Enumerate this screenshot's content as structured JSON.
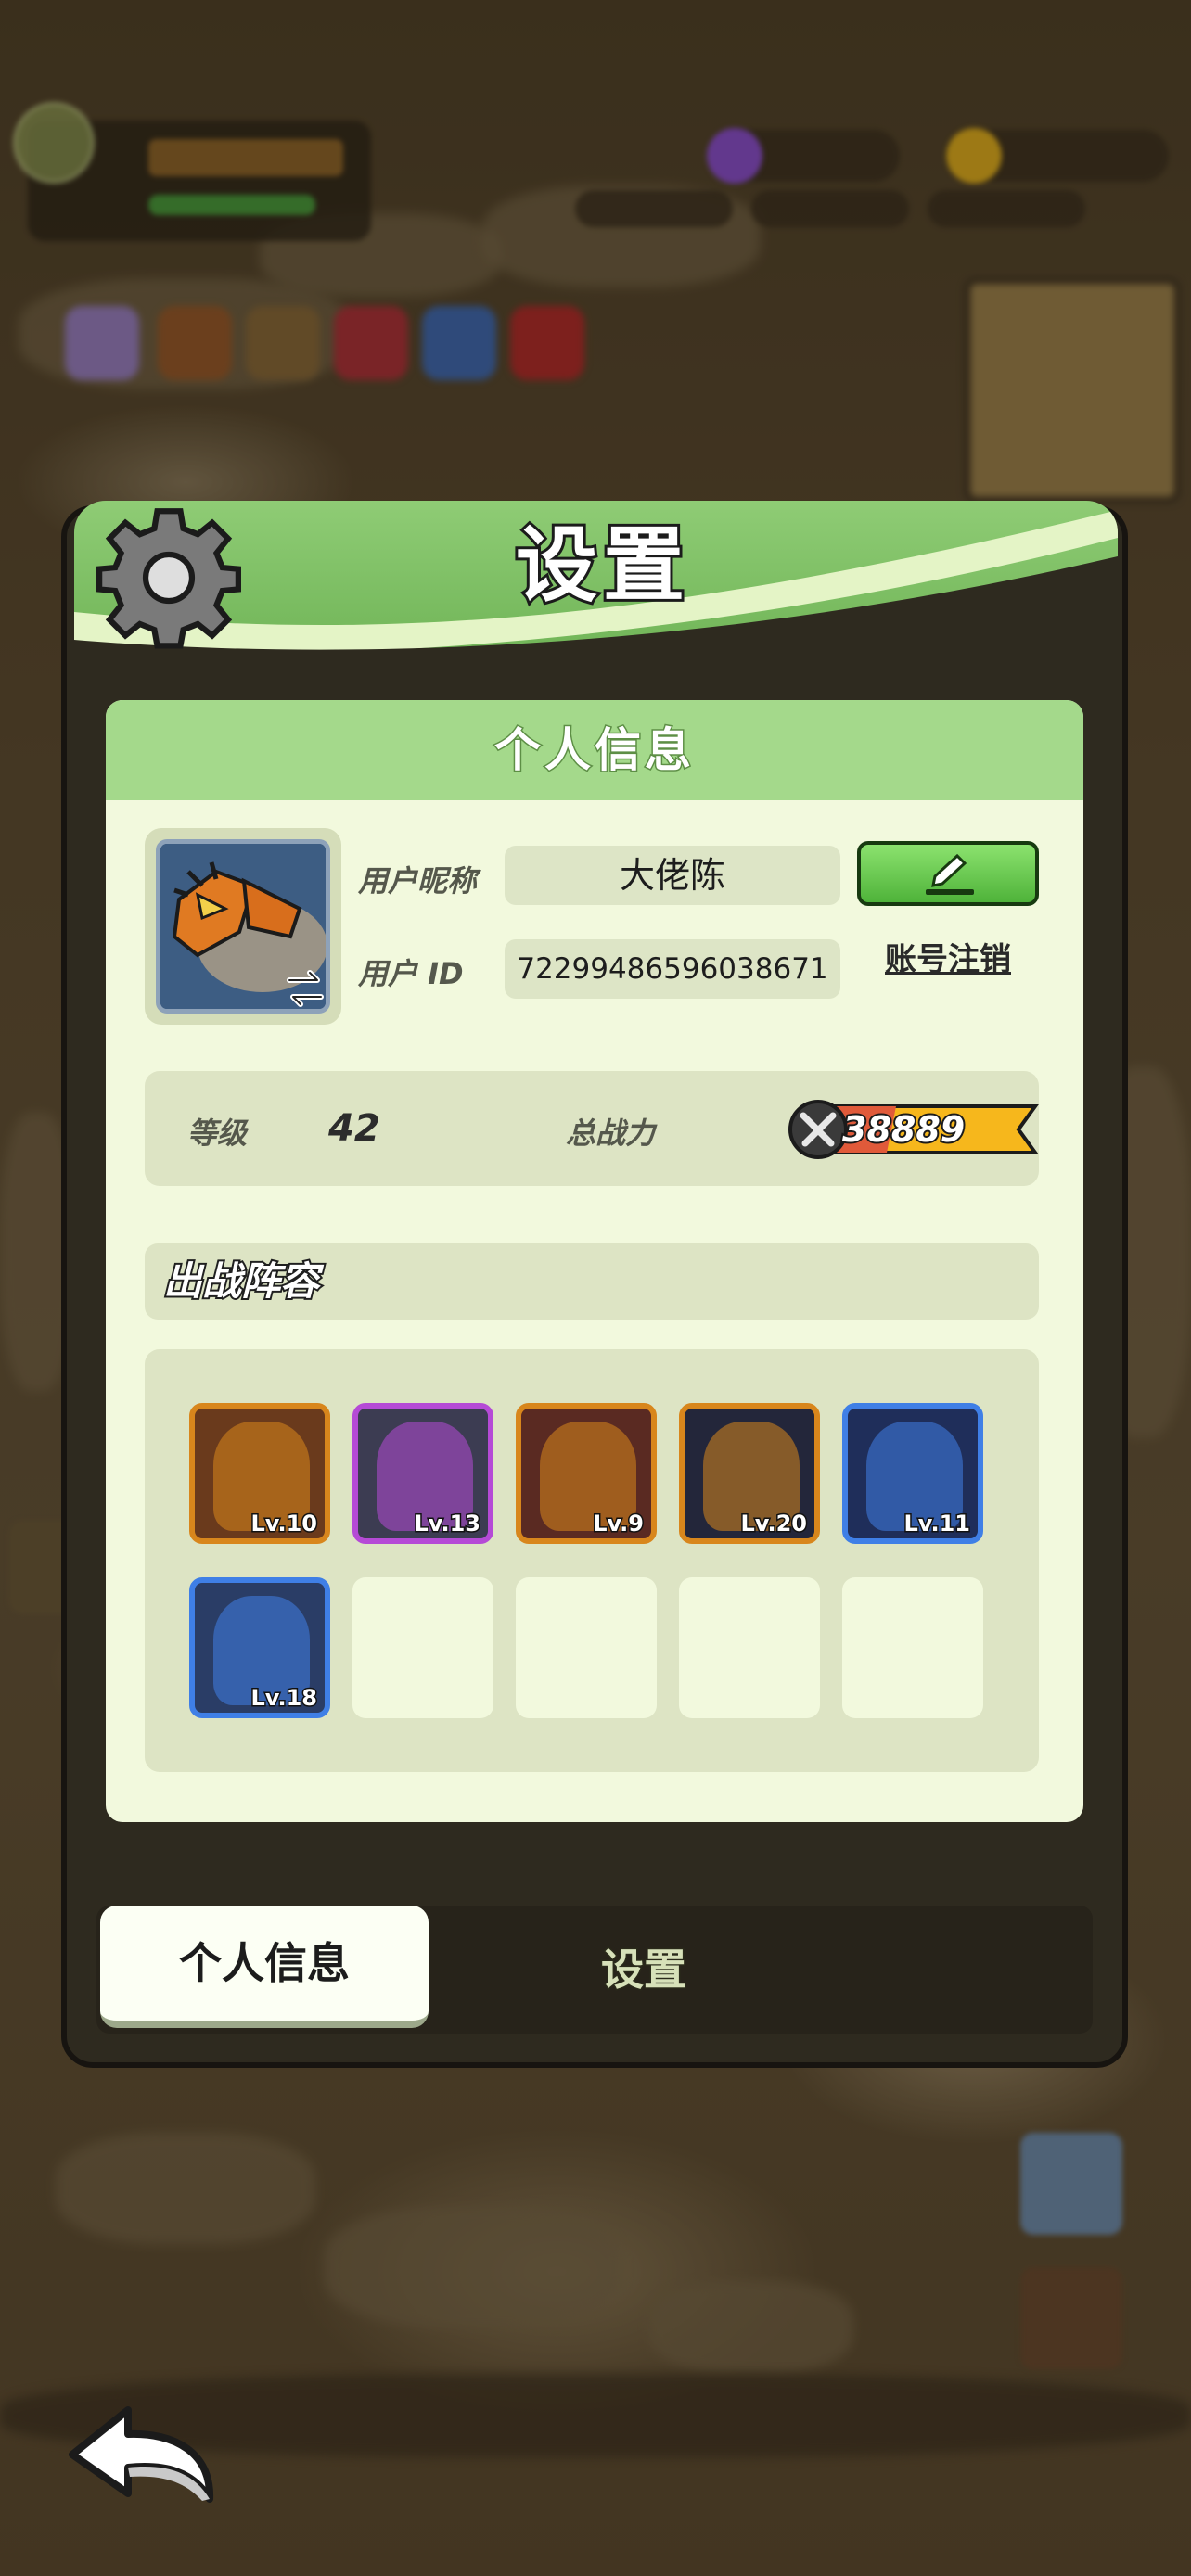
{
  "panel": {
    "title": "设置"
  },
  "profile": {
    "section_title": "个人信息",
    "nickname_label": "用户昵称",
    "nickname": "大佬陈",
    "id_label": "用户  ID",
    "user_id": "72299486596038671",
    "cancel_account": "账号注销"
  },
  "stats": {
    "level_label": "等级",
    "level": "42",
    "power_label": "总战力",
    "power": "38889"
  },
  "lineup": {
    "title": "出战阵容",
    "heroes": [
      {
        "level": "Lv.10",
        "frame": "#d8861c",
        "bg": "#6a3a1c"
      },
      {
        "level": "Lv.13",
        "frame": "#b54ad6",
        "bg": "#3c3c52"
      },
      {
        "level": "Lv.9",
        "frame": "#d8861c",
        "bg": "#5a2a22"
      },
      {
        "level": "Lv.20",
        "frame": "#d8861c",
        "bg": "#23263a"
      },
      {
        "level": "Lv.11",
        "frame": "#3f7fe6",
        "bg": "#1f2e5a"
      },
      {
        "level": "Lv.18",
        "frame": "#3f7fe6",
        "bg": "#2a3d66"
      }
    ]
  },
  "tabs": {
    "active": "个人信息",
    "inactive": "设置"
  },
  "colors": {
    "header_green": "#7dbf63",
    "card_bg": "#f2f9dd",
    "edit_green": "#5fc04a",
    "power_orange": "#f6b71c"
  }
}
